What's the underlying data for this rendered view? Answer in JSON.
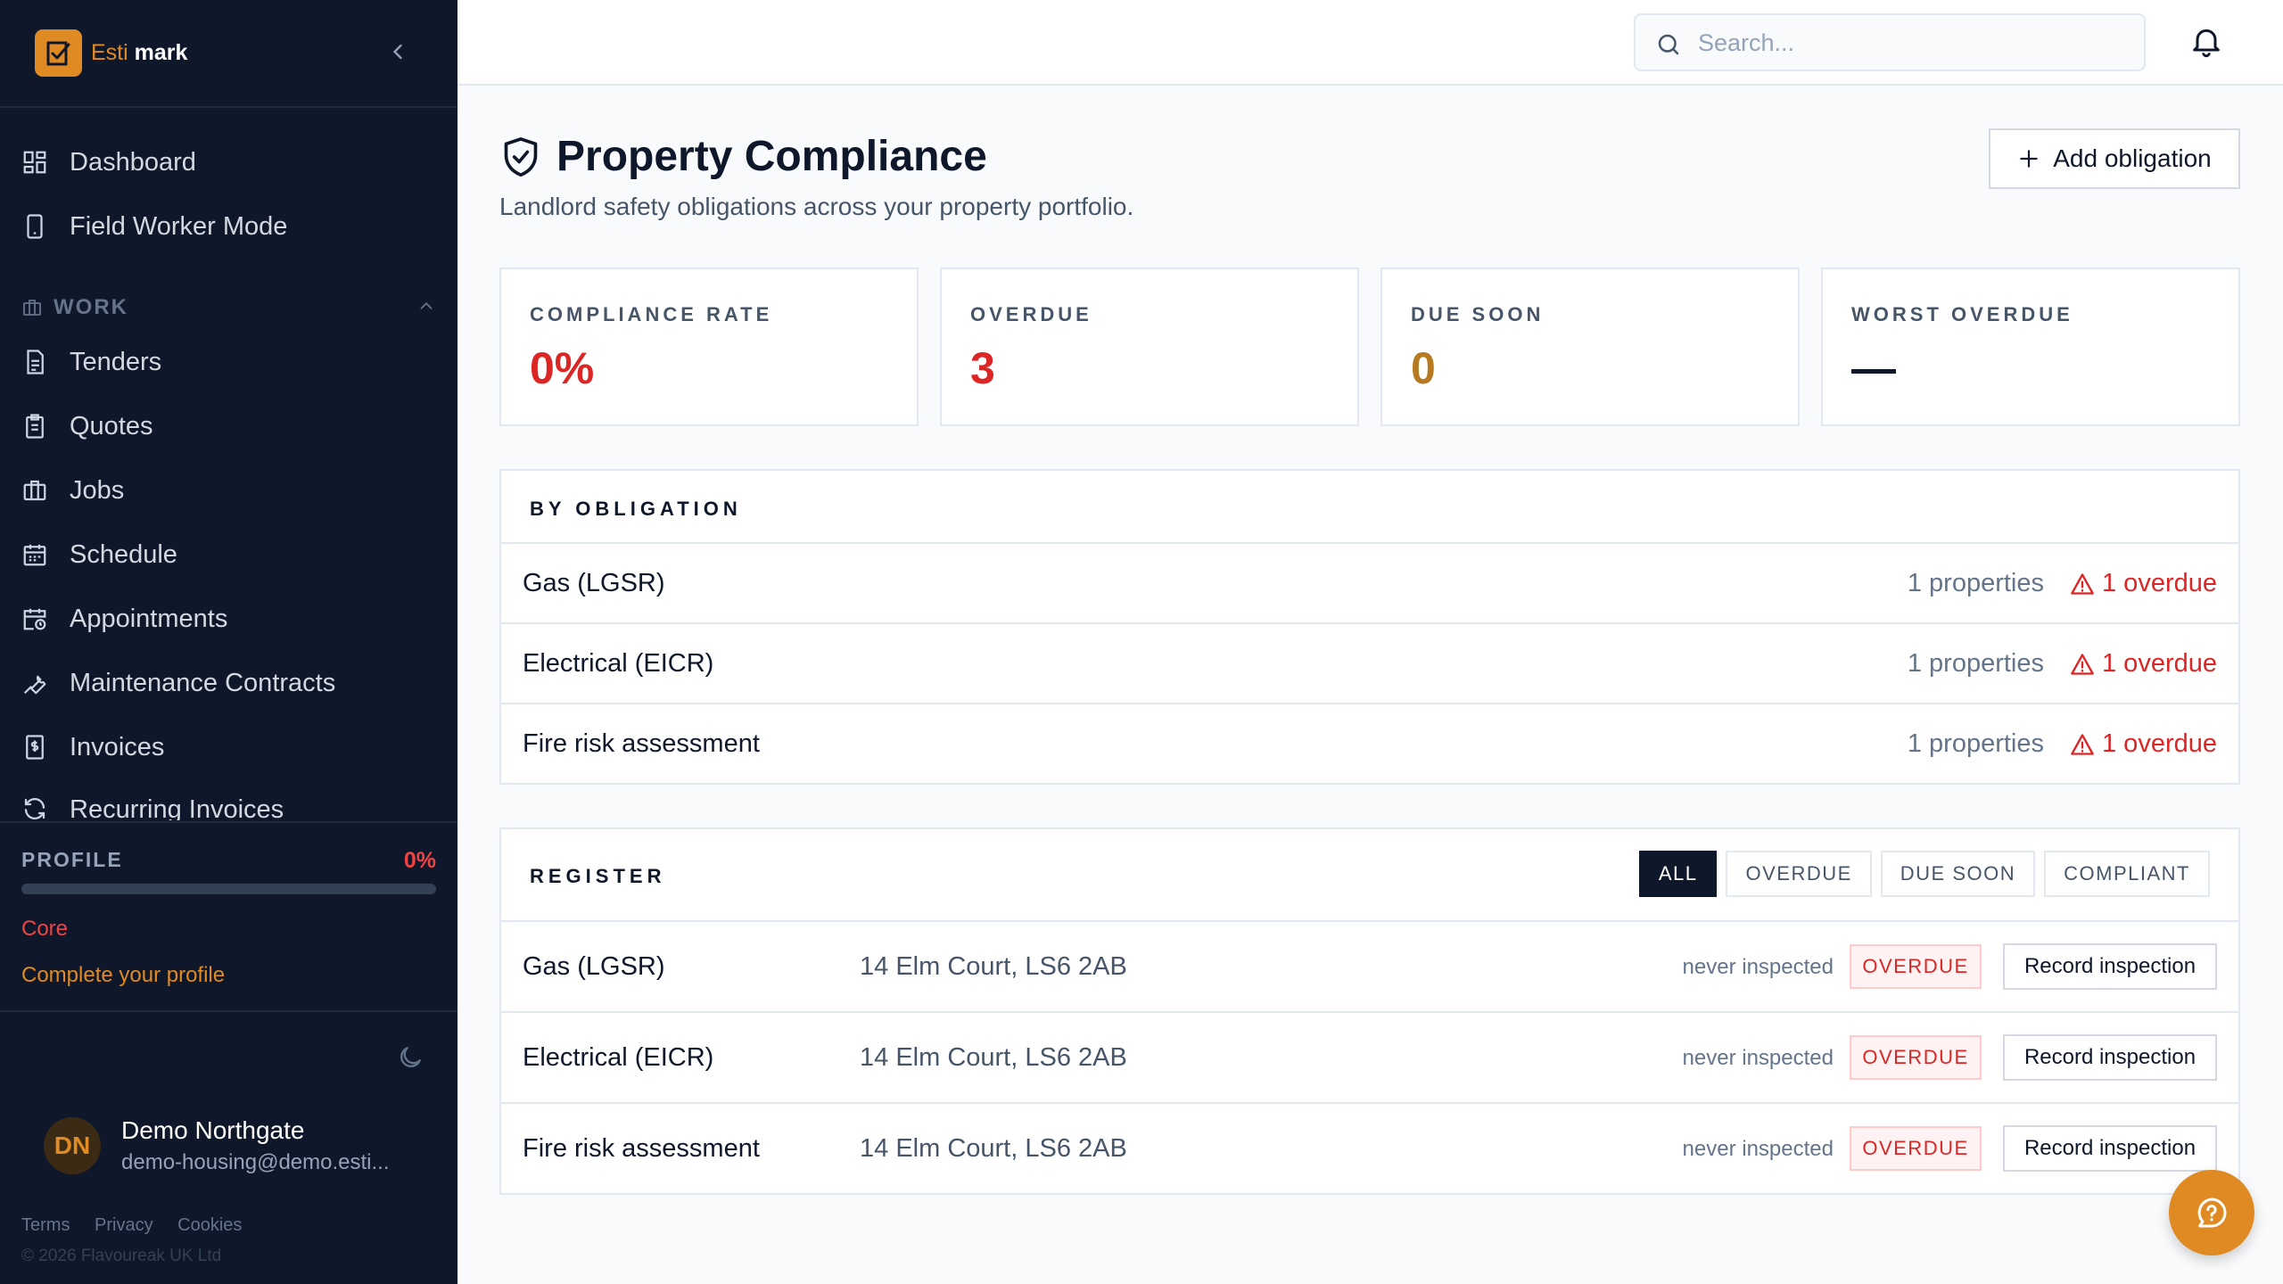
{
  "brand": {
    "name_part1": "Esti",
    "name_part2": "mark"
  },
  "nav": {
    "top_items": [
      {
        "label": "Dashboard",
        "icon": "dashboard-icon"
      },
      {
        "label": "Field Worker Mode",
        "icon": "phone-icon"
      }
    ],
    "work_section": {
      "label": "WORK",
      "items": [
        {
          "label": "Tenders",
          "icon": "document-icon"
        },
        {
          "label": "Quotes",
          "icon": "clipboard-icon"
        },
        {
          "label": "Jobs",
          "icon": "briefcase-icon"
        },
        {
          "label": "Schedule",
          "icon": "calendar-icon"
        },
        {
          "label": "Appointments",
          "icon": "calendar-clock-icon"
        },
        {
          "label": "Maintenance Contracts",
          "icon": "wrench-icon"
        },
        {
          "label": "Invoices",
          "icon": "invoice-icon"
        },
        {
          "label": "Recurring Invoices",
          "icon": "refresh-icon"
        }
      ]
    }
  },
  "profile": {
    "label": "PROFILE",
    "completion_label": "0%",
    "completion": 0,
    "tier": "Core",
    "link": "Complete your profile"
  },
  "user": {
    "initials": "DN",
    "name": "Demo Northgate",
    "email": "demo-housing@demo.esti..."
  },
  "footer": {
    "terms": "Terms",
    "privacy": "Privacy",
    "cookies": "Cookies",
    "copyright": "© 2026 Flavoureak UK Ltd"
  },
  "header": {
    "search_placeholder": "Search..."
  },
  "page": {
    "title": "Property Compliance",
    "subtitle": "Landlord safety obligations across your property portfolio.",
    "add_button": "Add obligation"
  },
  "stats": [
    {
      "label": "COMPLIANCE RATE",
      "value": "0%",
      "color": "#dc2626"
    },
    {
      "label": "OVERDUE",
      "value": "3",
      "color": "#dc2626"
    },
    {
      "label": "DUE SOON",
      "value": "0",
      "color": "#b7791f"
    },
    {
      "label": "WORST OVERDUE",
      "value": "—",
      "color": "#0f172a"
    }
  ],
  "by_obligation": {
    "title": "BY OBLIGATION",
    "rows": [
      {
        "name": "Gas (LGSR)",
        "count": "1 properties",
        "overdue": "1 overdue"
      },
      {
        "name": "Electrical (EICR)",
        "count": "1 properties",
        "overdue": "1 overdue"
      },
      {
        "name": "Fire risk assessment",
        "count": "1 properties",
        "overdue": "1 overdue"
      }
    ]
  },
  "register": {
    "title": "REGISTER",
    "filters": [
      "ALL",
      "OVERDUE",
      "DUE SOON",
      "COMPLIANT"
    ],
    "active_filter": "ALL",
    "rows": [
      {
        "name": "Gas (LGSR)",
        "address": "14 Elm Court, LS6 2AB",
        "inspected": "never inspected",
        "status": "OVERDUE",
        "action": "Record inspection"
      },
      {
        "name": "Electrical (EICR)",
        "address": "14 Elm Court, LS6 2AB",
        "inspected": "never inspected",
        "status": "OVERDUE",
        "action": "Record inspection"
      },
      {
        "name": "Fire risk assessment",
        "address": "14 Elm Court, LS6 2AB",
        "inspected": "never inspected",
        "status": "OVERDUE",
        "action": "Record inspection"
      }
    ]
  },
  "colors": {
    "accent": "#e08a23",
    "sidebar_bg": "#0f172a",
    "danger": "#dc2626",
    "warning": "#b7791f"
  }
}
